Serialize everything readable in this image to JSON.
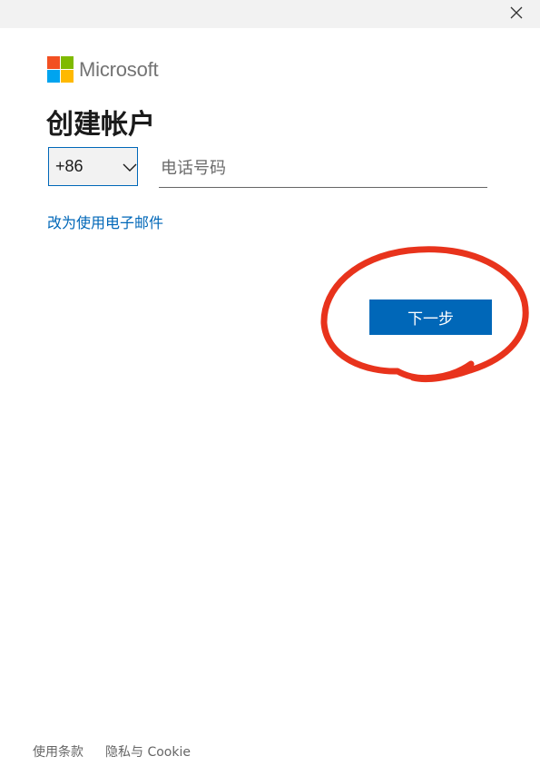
{
  "window": {
    "close_icon": "close-icon"
  },
  "logo": {
    "text": "Microsoft",
    "colors": [
      "#f25022",
      "#7fba00",
      "#00a4ef",
      "#ffb900"
    ]
  },
  "page": {
    "title": "创建帐户"
  },
  "country_select": {
    "value": "+86",
    "icon": "chevron-down-icon"
  },
  "phone_input": {
    "placeholder": "电话号码",
    "value": ""
  },
  "switch_link": {
    "label": "改为使用电子邮件"
  },
  "next_button": {
    "label": "下一步"
  },
  "annotation": {
    "color": "#e8331c"
  },
  "footer": {
    "terms": "使用条款",
    "privacy": "隐私与 Cookie"
  },
  "colors": {
    "accent": "#0067b8",
    "titlebar": "#f2f2f2"
  }
}
